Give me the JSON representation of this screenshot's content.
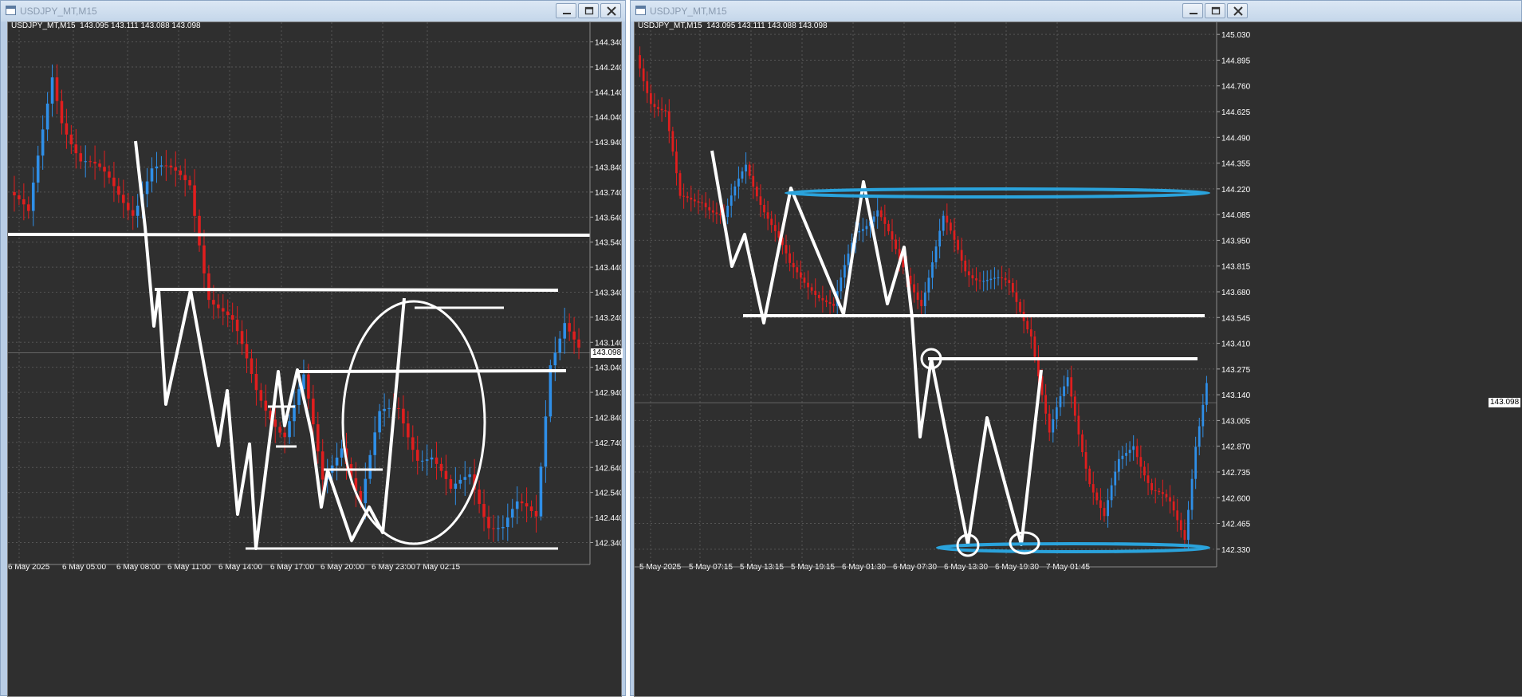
{
  "colors": {
    "background": "#2f2f2f",
    "grid": "#555555",
    "bull_candle": "#2f8fe8",
    "bear_candle": "#e01e1e",
    "annotation_white": "#ffffff",
    "annotation_blue": "#2aa3dc",
    "axis_text": "#ffffff"
  },
  "windows": [
    {
      "title": "USDJPY_MT,M15",
      "info_line": "USDJPY_MT,M15  143.095 143.111 143.088 143.098",
      "price_badge": "143.098",
      "y_labels": [
        "144.340",
        "144.240",
        "144.140",
        "144.040",
        "143.940",
        "143.840",
        "143.740",
        "143.640",
        "143.540",
        "143.440",
        "143.340",
        "143.240",
        "143.140",
        "143.040",
        "142.940",
        "142.840",
        "142.740",
        "142.640",
        "142.540",
        "142.440",
        "142.340"
      ],
      "x_labels": [
        "6 May 2025",
        "6 May 05:00",
        "6 May 08:00",
        "6 May 11:00",
        "6 May 14:00",
        "6 May 17:00",
        "6 May 20:00",
        "6 May 23:00",
        "7 May 02:15"
      ]
    },
    {
      "title": "USDJPY_MT,M15",
      "info_line": "USDJPY_MT,M15  143.095 143.111 143.088 143.098",
      "price_badge": "143.098",
      "y_labels": [
        "145.030",
        "144.895",
        "144.760",
        "144.625",
        "144.490",
        "144.355",
        "144.220",
        "144.085",
        "143.950",
        "143.815",
        "143.680",
        "143.545",
        "143.410",
        "143.275",
        "143.140",
        "143.005",
        "142.870",
        "142.735",
        "142.600",
        "142.465",
        "142.330"
      ],
      "x_labels": [
        "5 May 2025",
        "5 May 07:15",
        "5 May 13:15",
        "5 May 19:15",
        "6 May 01:30",
        "6 May 07:30",
        "6 May 13:30",
        "6 May 19:30",
        "7 May 01:45"
      ]
    }
  ],
  "chart_data": [
    {
      "type": "candlestick",
      "title": "USDJPY_MT,M15",
      "ylim": [
        142.3,
        144.38
      ],
      "y_ticks": [
        144.34,
        144.24,
        144.14,
        144.04,
        143.94,
        143.84,
        143.74,
        143.64,
        143.54,
        143.44,
        143.34,
        143.24,
        143.14,
        143.04,
        142.94,
        142.84,
        142.74,
        142.64,
        142.54,
        142.44,
        142.34
      ],
      "x_labels": [
        "6 May 2025",
        "6 May 05:00",
        "6 May 08:00",
        "6 May 11:00",
        "6 May 14:00",
        "6 May 17:00",
        "6 May 20:00",
        "6 May 23:00",
        "7 May 02:15"
      ],
      "current_price": 143.098,
      "anchors": [
        [
          0,
          143.74
        ],
        [
          4,
          143.63
        ],
        [
          9,
          144.22
        ],
        [
          11,
          144.05
        ],
        [
          15,
          143.86
        ],
        [
          21,
          143.78
        ],
        [
          26,
          143.68
        ],
        [
          30,
          143.83
        ],
        [
          38,
          143.78
        ],
        [
          42,
          143.34
        ],
        [
          47,
          143.2
        ],
        [
          52,
          142.95
        ],
        [
          58,
          142.78
        ],
        [
          62,
          142.98
        ],
        [
          66,
          142.58
        ],
        [
          70,
          142.75
        ],
        [
          74,
          142.5
        ],
        [
          78,
          142.83
        ],
        [
          82,
          142.88
        ],
        [
          86,
          142.7
        ],
        [
          89,
          142.68
        ],
        [
          93,
          142.52
        ],
        [
          97,
          142.62
        ],
        [
          101,
          142.43
        ],
        [
          104,
          142.4
        ],
        [
          107,
          142.47
        ],
        [
          111,
          142.44
        ],
        [
          114,
          143.08
        ],
        [
          117,
          143.24
        ],
        [
          120,
          143.1
        ]
      ],
      "n": 121
    },
    {
      "type": "candlestick",
      "title": "USDJPY_MT,M15",
      "ylim": [
        142.3,
        145.06
      ],
      "y_ticks": [
        145.03,
        144.895,
        144.76,
        144.625,
        144.49,
        144.355,
        144.22,
        144.085,
        143.95,
        143.815,
        143.68,
        143.545,
        143.41,
        143.275,
        143.14,
        143.005,
        142.87,
        142.735,
        142.6,
        142.465,
        142.33
      ],
      "x_labels": [
        "5 May 2025",
        "5 May 07:15",
        "5 May 13:15",
        "5 May 19:15",
        "6 May 01:30",
        "6 May 07:30",
        "6 May 13:30",
        "6 May 19:30",
        "7 May 01:45"
      ],
      "current_price": 143.098,
      "anchors": [
        [
          0,
          144.92
        ],
        [
          4,
          144.7
        ],
        [
          8,
          144.62
        ],
        [
          12,
          144.15
        ],
        [
          18,
          144.18
        ],
        [
          24,
          144.05
        ],
        [
          30,
          144.35
        ],
        [
          36,
          144.08
        ],
        [
          42,
          143.8
        ],
        [
          48,
          143.72
        ],
        [
          54,
          143.58
        ],
        [
          60,
          144.0
        ],
        [
          66,
          144.12
        ],
        [
          72,
          143.82
        ],
        [
          78,
          143.64
        ],
        [
          84,
          144.05
        ],
        [
          90,
          143.8
        ],
        [
          96,
          143.75
        ],
        [
          102,
          143.7
        ],
        [
          108,
          143.48
        ],
        [
          113,
          142.92
        ],
        [
          118,
          143.22
        ],
        [
          124,
          142.7
        ],
        [
          128,
          142.48
        ],
        [
          132,
          142.78
        ],
        [
          136,
          142.9
        ],
        [
          141,
          142.64
        ],
        [
          146,
          142.55
        ],
        [
          150,
          142.4
        ],
        [
          153,
          142.9
        ],
        [
          156,
          143.2
        ]
      ],
      "n": 157
    }
  ]
}
